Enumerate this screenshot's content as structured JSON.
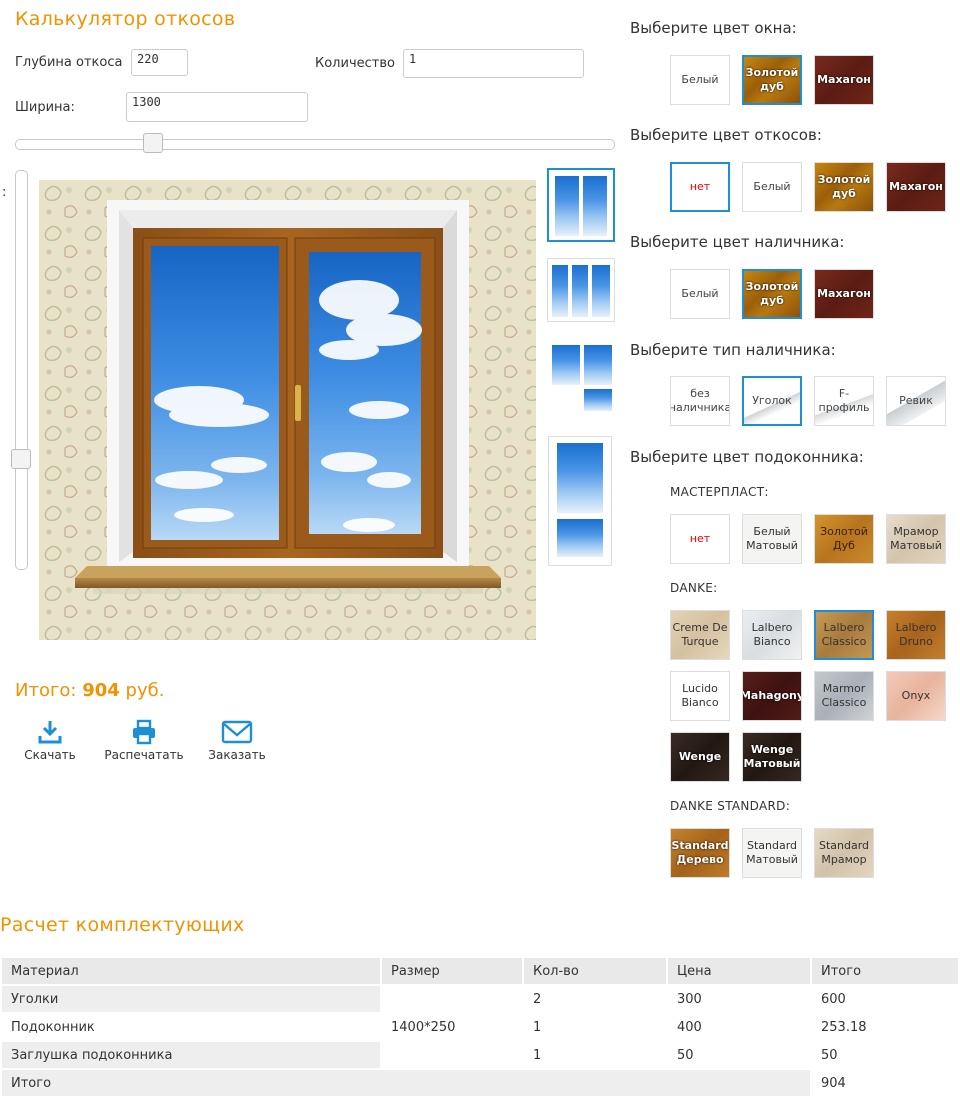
{
  "title": "Калькулятор откосов",
  "depth": {
    "label": "Глубина откоса",
    "value": "220"
  },
  "quantity": {
    "label": "Количество",
    "value": "1"
  },
  "width": {
    "label": "Ширина:",
    "value": "1300"
  },
  "vertical_slider_label": ":",
  "total": {
    "prefix": "Итого: ",
    "value": "904",
    "suffix": " руб."
  },
  "actions": [
    {
      "label": "Скачать",
      "icon": "download-icon"
    },
    {
      "label": "Распечатать",
      "icon": "printer-icon"
    },
    {
      "label": "Заказать",
      "icon": "envelope-icon"
    }
  ],
  "window_color": {
    "heading": "Выберите цвет окна:",
    "options": [
      "Белый",
      "Золотой дуб",
      "Махагон"
    ],
    "selected": "Золотой дуб"
  },
  "slope_color": {
    "heading": "Выберите цвет откосов:",
    "options": [
      "нет",
      "Белый",
      "Золотой дуб",
      "Махагон"
    ],
    "selected": "нет"
  },
  "trim_color": {
    "heading": "Выберите цвет наличника:",
    "options": [
      "Белый",
      "Золотой дуб",
      "Махагон"
    ],
    "selected": "Золотой дуб"
  },
  "trim_type": {
    "heading": "Выберите тип наличника:",
    "options": [
      "без наличника",
      "Уголок",
      "F-профиль",
      "Ревик"
    ],
    "selected": "Уголок"
  },
  "sill_color": {
    "heading": "Выберите цвет подоконника:",
    "groups": [
      {
        "name": "МАСТЕРПЛАСТ:",
        "options": [
          "нет",
          "Белый Матовый",
          "Золотой Дуб",
          "Мрамор Матовый"
        ]
      },
      {
        "name": "DANKE:",
        "options": [
          "Creme De Turque",
          "Lalbero Bianco",
          "Lalbero Classico",
          "Lalbero Druno",
          "Lucido Bianco",
          "Mahagony",
          "Marmor Classico",
          "Onyx",
          "Wenge",
          "Wenge Матовый"
        ],
        "selected": "Lalbero Classico"
      },
      {
        "name": "DANKE STANDARD:",
        "options": [
          "Standard Дерево",
          "Standard Матовый",
          "Standard Мрамор"
        ]
      }
    ]
  },
  "components": {
    "heading": "Расчет комплектующих",
    "columns": [
      "Материал",
      "Размер",
      "Кол-во",
      "Цена",
      "Итого"
    ],
    "rows": [
      [
        "Уголки",
        "",
        "2",
        "300",
        "600"
      ],
      [
        "Подоконник",
        "1400*250",
        "1",
        "400",
        "253.18"
      ],
      [
        "Заглушка подоконника",
        "",
        "1",
        "50",
        "50"
      ]
    ],
    "footer": {
      "label": "Итого",
      "value": "904"
    }
  },
  "colors": {
    "accent": "#f39200",
    "selected_border": "#1d8fd5",
    "icon_blue": "#1d8fd5"
  }
}
